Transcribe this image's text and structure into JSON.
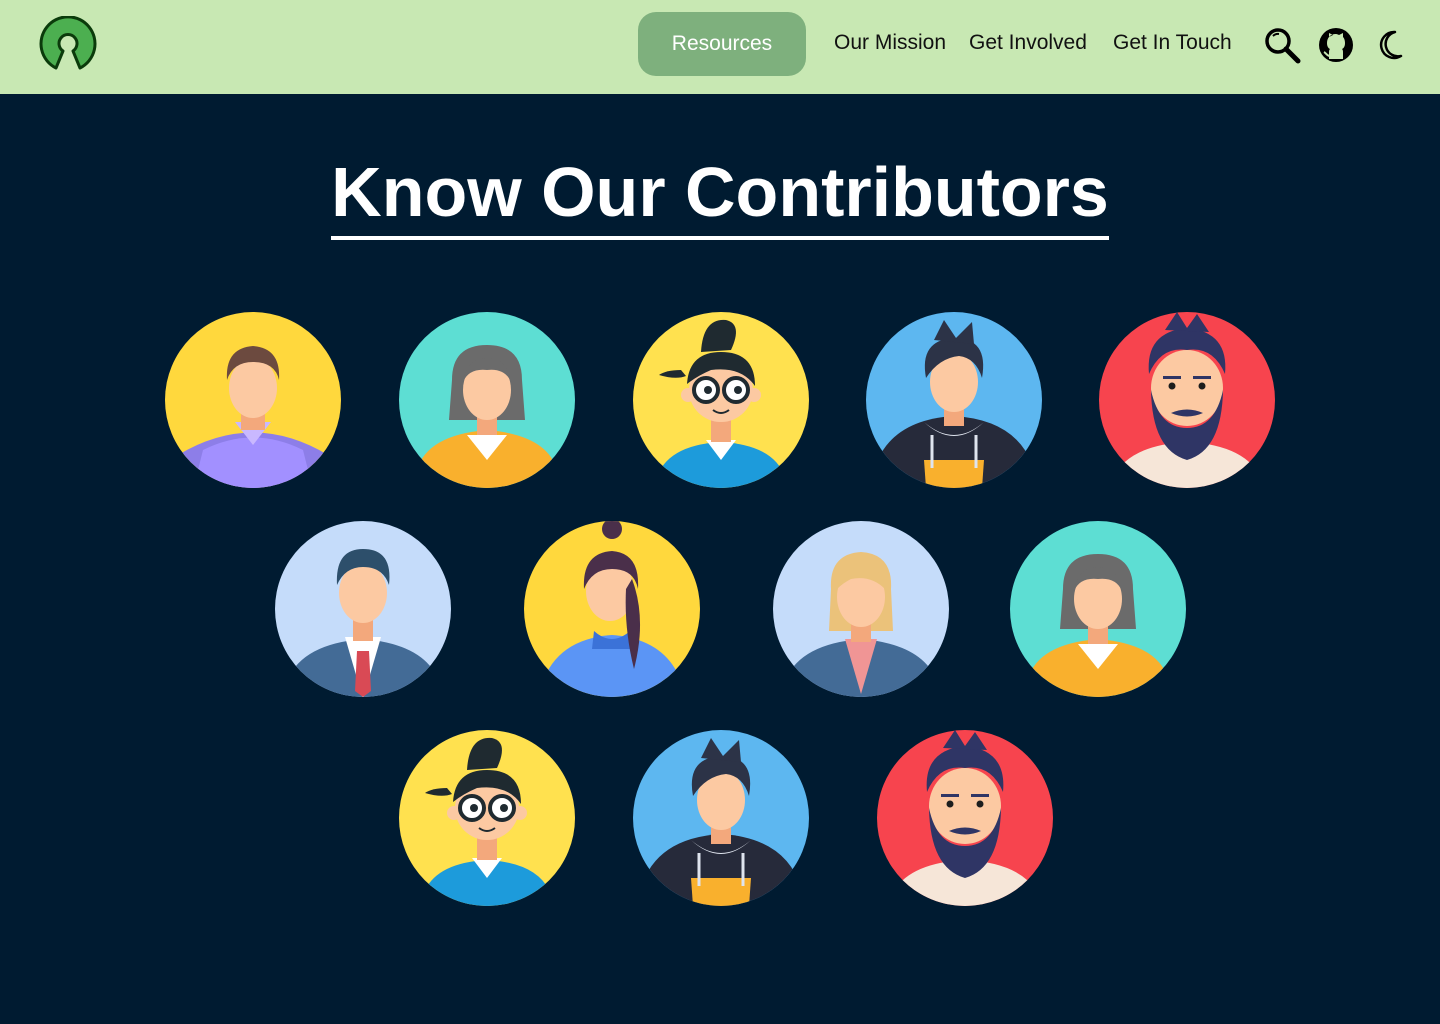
{
  "nav": {
    "resources_label": "Resources",
    "links": [
      {
        "label": "Our Mission"
      },
      {
        "label": "Get Involved"
      },
      {
        "label": "Get In Touch"
      }
    ],
    "icons": [
      "search-icon",
      "github-icon",
      "moon-icon"
    ]
  },
  "title": "Know Our Contributors",
  "colors": {
    "nav_bg": "#c8e8b3",
    "page_bg": "#001b31",
    "accent_button": "#7eb07d",
    "logo_green": "#4caf50"
  },
  "contributors": [
    {
      "avatar": "man-purple-shirt",
      "bg": "#ffd83d"
    },
    {
      "avatar": "woman-grey-hair",
      "bg": "#5dded3"
    },
    {
      "avatar": "girl-glasses",
      "bg": "#ffe14f"
    },
    {
      "avatar": "man-hoodie",
      "bg": "#5db7f0"
    },
    {
      "avatar": "bearded-man",
      "bg": "#f7444e"
    },
    {
      "avatar": "man-suit",
      "bg": "#c5dcfa"
    },
    {
      "avatar": "woman-ponytail",
      "bg": "#ffd83d"
    },
    {
      "avatar": "woman-blonde-suit",
      "bg": "#c5dcfa"
    },
    {
      "avatar": "woman-grey-hair",
      "bg": "#5dded3"
    },
    {
      "avatar": "girl-glasses",
      "bg": "#ffe14f"
    },
    {
      "avatar": "man-hoodie",
      "bg": "#5db7f0"
    },
    {
      "avatar": "bearded-man",
      "bg": "#f7444e"
    }
  ]
}
